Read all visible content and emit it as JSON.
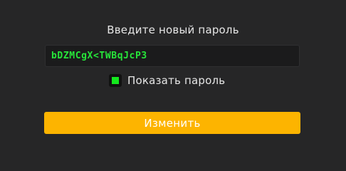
{
  "dialog": {
    "title": "Введите новый пароль",
    "password_value": "bDZMCgX<TWBqJcP3",
    "show_password": {
      "label": "Показать пароль",
      "checked": true
    },
    "submit_label": "Изменить"
  },
  "colors": {
    "background": "#262627",
    "field_text": "#27e53a",
    "checkbox_fill": "#14e81e",
    "button": "#fdb400"
  }
}
